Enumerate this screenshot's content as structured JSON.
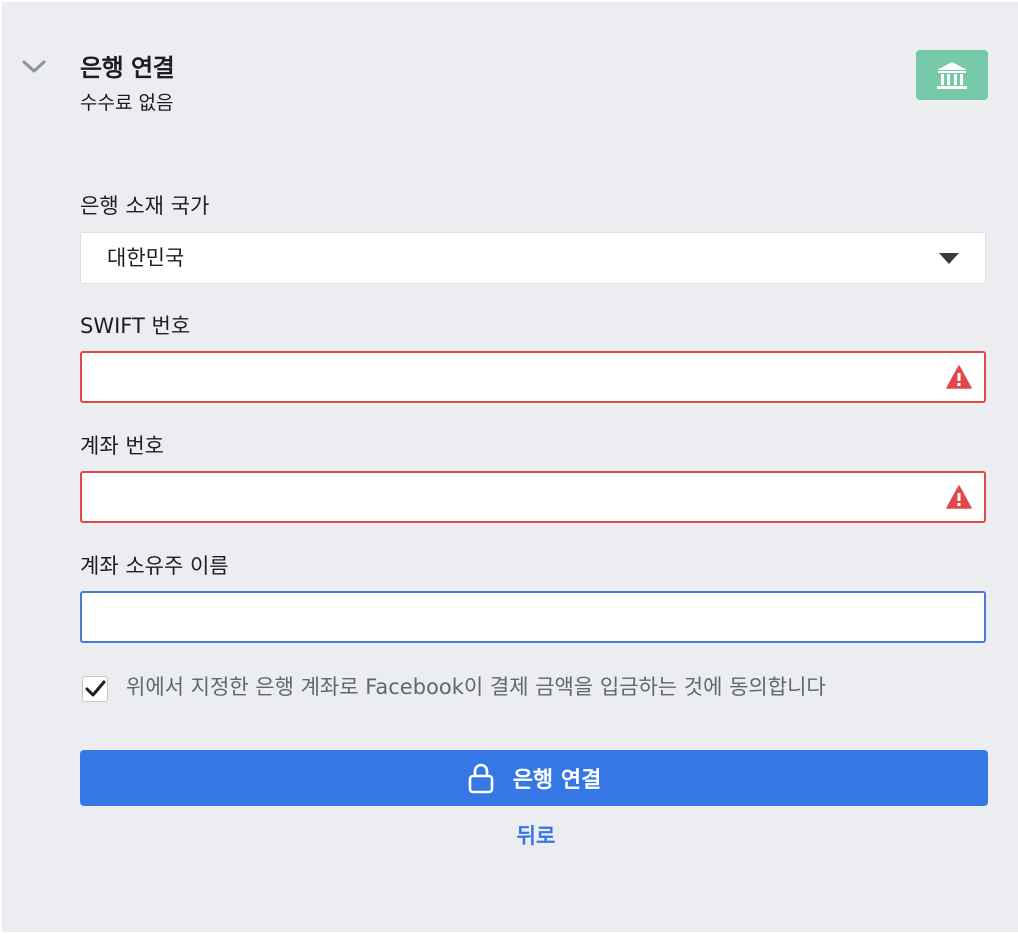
{
  "header": {
    "title": "은행 연결",
    "subtitle": "수수료 없음",
    "collapse_icon": "chevron-down-icon",
    "badge_icon": "bank-icon",
    "badge_color": "#75c9a8"
  },
  "form": {
    "country": {
      "label": "은행 소재 국가",
      "value": "대한민국"
    },
    "swift": {
      "label": "SWIFT 번호",
      "value": "",
      "status": "error"
    },
    "account_number": {
      "label": "계좌 번호",
      "value": "",
      "status": "error"
    },
    "account_holder": {
      "label": "계좌 소유주 이름",
      "value": "",
      "status": "focused"
    },
    "agreement": {
      "checked": true,
      "text": "위에서 지정한 은행 계좌로 Facebook이 결제 금액을 입금하는 것에 동의합니다"
    }
  },
  "actions": {
    "connect_label": "은행 연결",
    "back_label": "뒤로"
  },
  "colors": {
    "primary": "#3578e5",
    "error": "#e0484a",
    "panel_bg": "#ebedf0"
  }
}
